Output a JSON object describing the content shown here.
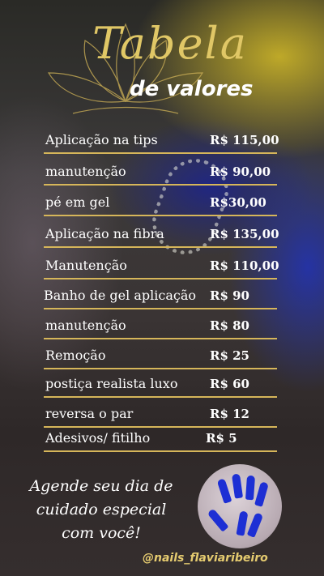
{
  "header": {
    "title": "Tabela",
    "subtitle": "de valores"
  },
  "price_list": [
    {
      "name": "Aplicação na tips",
      "price": "R$ 115,00"
    },
    {
      "name": "manutenção",
      "price": "R$ 90,00"
    },
    {
      "name": "pé em gel",
      "price": "R$30,00"
    },
    {
      "name": "Aplicação na fibra",
      "price": "R$ 135,00"
    },
    {
      "name": "Manutenção",
      "price": "R$ 110,00"
    },
    {
      "name": "Banho de gel aplicação",
      "price": "R$ 90"
    },
    {
      "name": "manutenção",
      "price": "R$ 80"
    },
    {
      "name": "Remoção",
      "price": "R$ 25"
    },
    {
      "name": "postiça realista luxo",
      "price": "R$ 60"
    },
    {
      "name": "reversa o par",
      "price": "R$ 12"
    },
    {
      "name": "Adesivos/ fitilho",
      "price": "R$ 5"
    }
  ],
  "footer": {
    "cta_lines": [
      "Agende seu dia de",
      "cuidado especial",
      "com você!"
    ],
    "handle": "@nails_flaviaribeiro"
  },
  "colors": {
    "gold": "#d6b65a",
    "text": "#ffffff",
    "nail_blue": "#1d2fd4"
  }
}
